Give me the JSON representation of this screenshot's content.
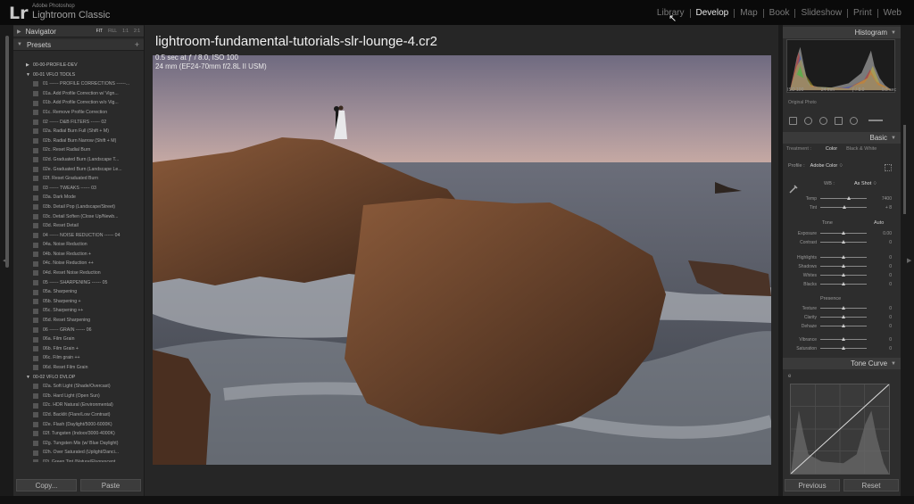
{
  "app": {
    "brand_small": "Adobe Photoshop",
    "brand_name": "Lightroom Classic",
    "logo": "Lr"
  },
  "modules": [
    "Library",
    "Develop",
    "Map",
    "Book",
    "Slideshow",
    "Print",
    "Web"
  ],
  "active_module": "Develop",
  "navigator": {
    "label": "Navigator",
    "options": [
      "FIT",
      "FILL",
      "1:1",
      "2:1"
    ]
  },
  "presets": {
    "label": "Presets",
    "rows": [
      {
        "type": "folder",
        "open": false,
        "label": "00-00-PROFILE-DEV"
      },
      {
        "type": "folder",
        "open": true,
        "label": "00-01 VFLO TOOLS"
      },
      {
        "type": "item",
        "label": "01 ------ PROFILE CORRECTIONS ------..."
      },
      {
        "type": "item",
        "label": "01a. Add Profile Correction w/ Vign..."
      },
      {
        "type": "item",
        "label": "01b. Add Profile Correction w/o Vig..."
      },
      {
        "type": "item",
        "label": "01c. Remove Profile Correction"
      },
      {
        "type": "item",
        "label": "02 ------ D&B FILTERS ------ 02"
      },
      {
        "type": "item",
        "label": "02a. Radial Burn Full (Shift + M)"
      },
      {
        "type": "item",
        "label": "02b. Radial Burn Narrow (Shift + M)"
      },
      {
        "type": "item",
        "label": "02c. Reset Radial Burn"
      },
      {
        "type": "item",
        "label": "02d. Graduated Burn (Landscape T..."
      },
      {
        "type": "item",
        "label": "02e. Graduated Burn (Landscape Le..."
      },
      {
        "type": "item",
        "label": "02f. Reset Graduated Burn"
      },
      {
        "type": "item",
        "label": "03 ------ TWEAKS ------ 03"
      },
      {
        "type": "item",
        "label": "03a. Dark Mode"
      },
      {
        "type": "item",
        "label": "03b. Detail Pop (Landscape/Street)"
      },
      {
        "type": "item",
        "label": "03c. Detail Soften (Close Up/Newb..."
      },
      {
        "type": "item",
        "label": "03d. Reset Detail"
      },
      {
        "type": "item",
        "label": "04 ------ NOISE REDUCTION ------ 04"
      },
      {
        "type": "item",
        "label": "04a. Noise Reduction"
      },
      {
        "type": "item",
        "label": "04b. Noise Reduction +"
      },
      {
        "type": "item",
        "label": "04c. Noise Reduction ++"
      },
      {
        "type": "item",
        "label": "04d. Reset Noise Reduction"
      },
      {
        "type": "item",
        "label": "05 ------ SHARPENING ------ 05"
      },
      {
        "type": "item",
        "label": "05a. Sharpening"
      },
      {
        "type": "item",
        "label": "05b. Sharpening +"
      },
      {
        "type": "item",
        "label": "05c. Sharpening ++"
      },
      {
        "type": "item",
        "label": "05d. Reset Sharpening"
      },
      {
        "type": "item",
        "label": "06 ------ GRAIN ------ 06"
      },
      {
        "type": "item",
        "label": "06a. Film Grain"
      },
      {
        "type": "item",
        "label": "06b. Film Grain +"
      },
      {
        "type": "item",
        "label": "06c. Film grain ++"
      },
      {
        "type": "item",
        "label": "06d. Reset Film Grain"
      },
      {
        "type": "folder",
        "open": true,
        "label": "00-02 VFLO DVLOP"
      },
      {
        "type": "item",
        "label": "02a. Soft Light (Shade/Overcast)"
      },
      {
        "type": "item",
        "label": "02b. Hard Light (Open Sun)"
      },
      {
        "type": "item",
        "label": "02c. HDR Natural (Environmental)"
      },
      {
        "type": "item",
        "label": "02d. Backlit (Flare/Low Contrast)"
      },
      {
        "type": "item",
        "label": "02e. Flash (Daylight/5000-6000K)"
      },
      {
        "type": "item",
        "label": "02f. Tungsten (Indoor/3000-4000K)"
      },
      {
        "type": "item",
        "label": "02g. Tungsten Mix (w/ Blue Daylight)"
      },
      {
        "type": "item",
        "label": "02h. Over Saturated (Uplight/Danci..."
      },
      {
        "type": "item",
        "label": "02i. Green Tint (Nature/Fluorescent..."
      },
      {
        "type": "item",
        "label": "02j. RAW/RAW (Images Only)"
      }
    ]
  },
  "left_buttons": {
    "copy": "Copy...",
    "paste": "Paste"
  },
  "image_info": {
    "filename": "lightroom-fundamental-tutorials-slr-lounge-4.cr2",
    "exposure": "0.5 sec at ƒ / 8.0, ISO 100",
    "lens": "24 mm (EF24-70mm f/2.8L II USM)"
  },
  "histogram": {
    "label": "Histogram",
    "info": [
      "ISO 100",
      "24 mm",
      "ƒ / 8.0",
      "0.5 sec"
    ],
    "original_photo": "Original Photo"
  },
  "basic": {
    "label": "Basic",
    "treatment_label": "Treatment :",
    "treatment_color": "Color",
    "treatment_bw": "Black & White",
    "profile_label": "Profile :",
    "profile_value": "Adobe Color ♢",
    "wb_label": "WB :",
    "wb_value": "As Shot ♢",
    "tone_label": "Tone",
    "auto_label": "Auto",
    "presence_label": "Presence",
    "sliders": [
      {
        "label": "Temp",
        "value": "7400",
        "pos": 0.62
      },
      {
        "label": "Tint",
        "value": "+ 8",
        "pos": 0.52
      },
      {
        "label": "Exposure",
        "value": "0.00",
        "pos": 0.5
      },
      {
        "label": "Contrast",
        "value": "0",
        "pos": 0.5
      },
      {
        "label": "Highlights",
        "value": "0",
        "pos": 0.5
      },
      {
        "label": "Shadows",
        "value": "0",
        "pos": 0.5
      },
      {
        "label": "Whites",
        "value": "0",
        "pos": 0.5
      },
      {
        "label": "Blacks",
        "value": "0",
        "pos": 0.5
      },
      {
        "label": "Texture",
        "value": "0",
        "pos": 0.5
      },
      {
        "label": "Clarity",
        "value": "0",
        "pos": 0.5
      },
      {
        "label": "Dehaze",
        "value": "0",
        "pos": 0.5
      },
      {
        "label": "Vibrance",
        "value": "0",
        "pos": 0.5
      },
      {
        "label": "Saturation",
        "value": "0",
        "pos": 0.5
      }
    ]
  },
  "tone_curve": {
    "label": "Tone Curve",
    "mode_icon": "e"
  },
  "right_buttons": {
    "previous": "Previous",
    "reset": "Reset"
  }
}
